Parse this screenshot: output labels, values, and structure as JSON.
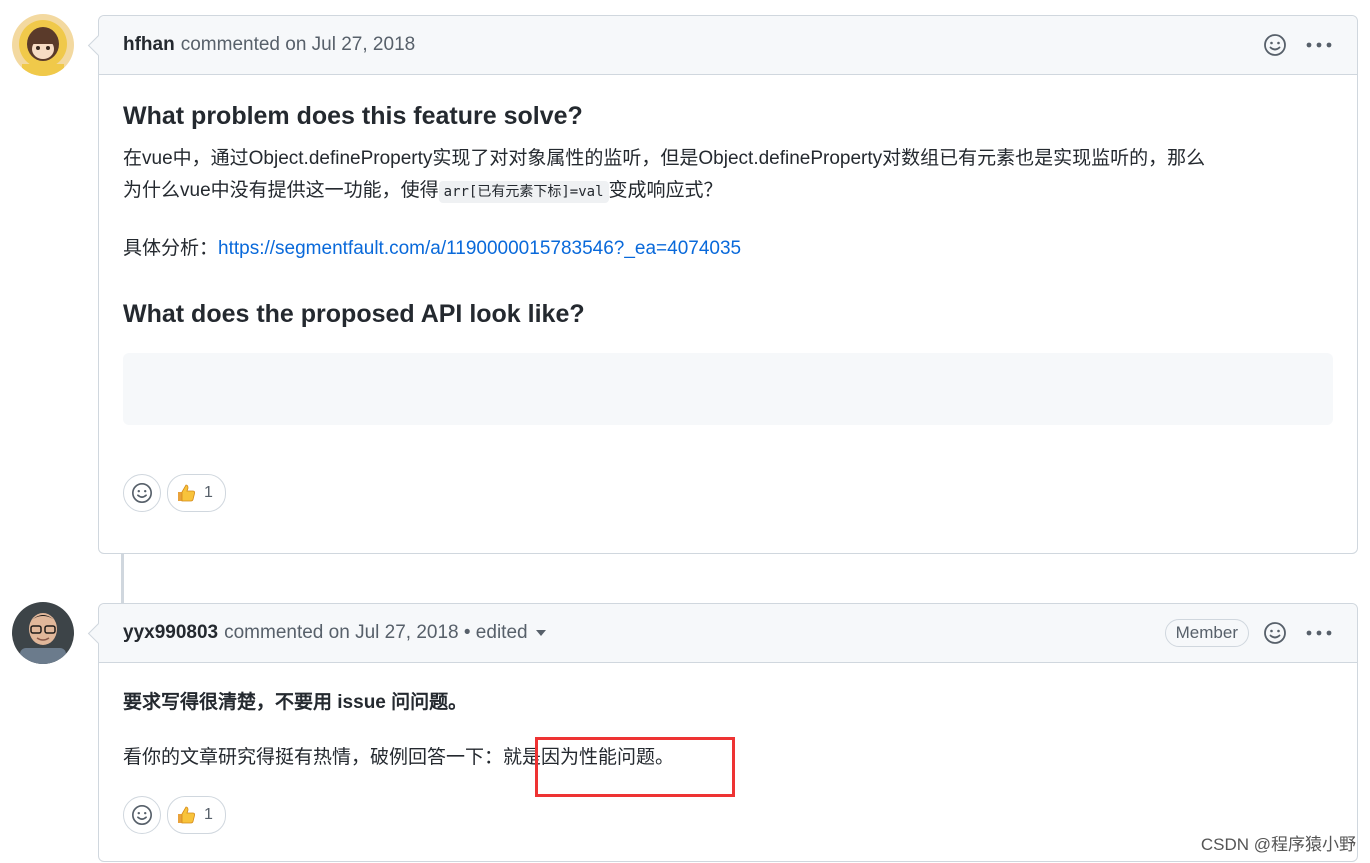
{
  "comments": [
    {
      "author": "hfhan",
      "meta": "commented on Jul 27, 2018",
      "heading1": "What problem does this feature solve?",
      "para1_a": "在vue中，通过Object.defineProperty实现了对对象属性的监听，但是Object.defineProperty对数组已有元素也是实现监听的，那么",
      "para1_b": "为什么vue中没有提供这一功能，使得",
      "para1_code": "arr[已有元素下标]=val",
      "para1_c": "变成响应式？",
      "para2_label": "具体分析：",
      "para2_link": "https://segmentfault.com/a/1190000015783546?_ea=4074035",
      "heading2": "What does the proposed API look like?",
      "reaction_count": "1"
    },
    {
      "author": "yyx990803",
      "meta": "commented on Jul 27, 2018 • edited",
      "badge": "Member",
      "bold_line": "要求写得很清楚，不要用 issue 问问题。",
      "line2_a": "看你的文章研究得挺有热情，破例回答一下：",
      "line2_b": "就是因为性能问题。",
      "reaction_count": "1"
    }
  ],
  "icons": {
    "smiley": "smiley-icon",
    "kebab": "kebab-icon",
    "thumbs_up": "thumbs-up-icon",
    "caret": "caret-down-icon"
  },
  "colors": {
    "link": "#0969da",
    "highlight": "#ee3333",
    "header_bg": "#f6f8fa",
    "border": "#d0d7de"
  },
  "watermark": "CSDN @程序猿小野"
}
